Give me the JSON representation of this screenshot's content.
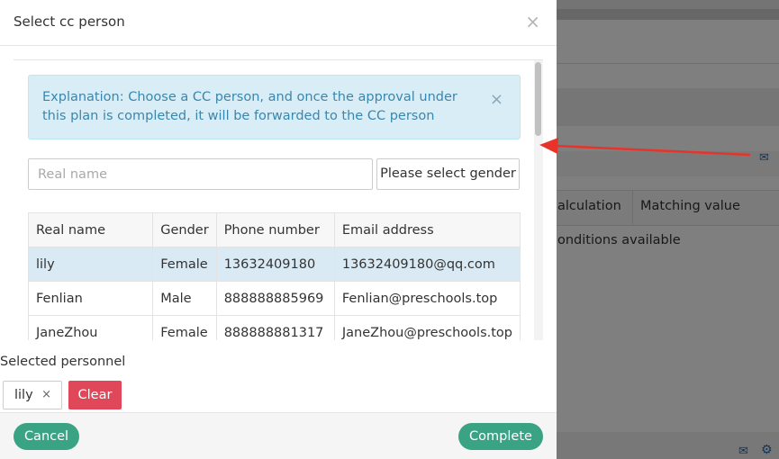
{
  "modal": {
    "title": "Select cc person",
    "close": "×",
    "alert": {
      "text": "Explanation: Choose a CC person, and once the approval under this plan is completed, it will be forwarded to the CC person",
      "close": "×"
    },
    "search": {
      "placeholder": "Real name",
      "value": ""
    },
    "gender_select": "Please select gender",
    "table": {
      "headers": [
        "Real name",
        "Gender",
        "Phone number",
        "Email address"
      ],
      "rows": [
        {
          "name": "lily",
          "gender": "Female",
          "phone": "13632409180",
          "email": "13632409180@qq.com",
          "selected": true
        },
        {
          "name": "Fenlian",
          "gender": "Male",
          "phone": "888888885969",
          "email": "Fenlian@preschools.top",
          "selected": false
        },
        {
          "name": "JaneZhou",
          "gender": "Female",
          "phone": "888888881317",
          "email": "JaneZhou@preschools.top",
          "selected": false
        }
      ]
    },
    "selected_label": "Selected personnel",
    "selected_tags": [
      {
        "name": "lily",
        "remove": "×"
      }
    ],
    "clear_label": "Clear",
    "cancel_label": "Cancel",
    "complete_label": "Complete"
  },
  "background": {
    "col_calculation": "alculation",
    "col_matching": "Matching value",
    "empty_text": "onditions available"
  },
  "colors": {
    "accent_green": "#3aa384",
    "danger_red": "#e0485a",
    "alert_bg": "#d9edf7",
    "selected_row": "#d9eaf5",
    "arrow": "#e8332a"
  },
  "icons": [
    "close-icon",
    "envelope-icon",
    "gears-icon",
    "arrow-annotation"
  ]
}
